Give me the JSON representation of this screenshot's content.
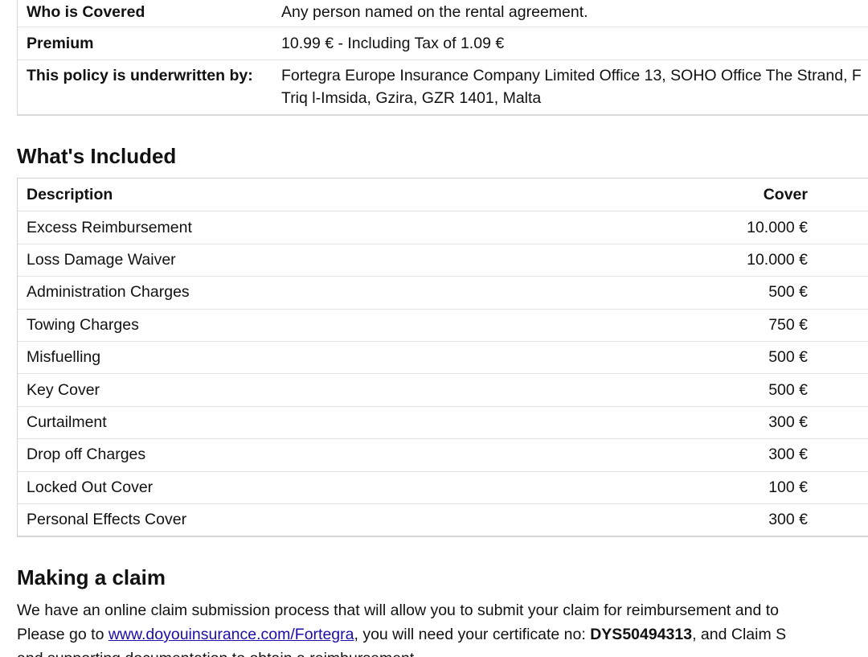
{
  "policy": {
    "rows": [
      {
        "label": "Who is Covered",
        "value": "Any person named on the rental agreement."
      },
      {
        "label": "Premium",
        "value": "10.99 € - Including Tax of 1.09 €"
      },
      {
        "label": "This policy is underwritten by:",
        "value_line1": "Fortegra Europe Insurance Company Limited Office 13, SOHO Office The Strand, F",
        "value_line2": "Triq l-Imsida, Gzira, GZR 1401, Malta"
      }
    ]
  },
  "included": {
    "title": "What's Included",
    "headers": {
      "description": "Description",
      "cover": "Cover"
    },
    "rows": [
      {
        "description": "Excess Reimbursement",
        "cover": "10.000 €"
      },
      {
        "description": "Loss Damage Waiver",
        "cover": "10.000 €"
      },
      {
        "description": "Administration Charges",
        "cover": "500 €"
      },
      {
        "description": "Towing Charges",
        "cover": "750 €"
      },
      {
        "description": "Misfuelling",
        "cover": "500 €"
      },
      {
        "description": "Key Cover",
        "cover": "500 €"
      },
      {
        "description": "Curtailment",
        "cover": "300 €"
      },
      {
        "description": "Drop off Charges",
        "cover": "300 €"
      },
      {
        "description": "Locked Out Cover",
        "cover": "100 €"
      },
      {
        "description": "Personal Effects Cover",
        "cover": "300 €"
      }
    ]
  },
  "claim": {
    "title": "Making a claim",
    "line1": "We have an online claim submission process that will allow you to submit your claim for reimbursement and to",
    "line2_before": "Please go to ",
    "link_text": "www.doyouinsurance.com/Fortegra",
    "line2_middle": ", you will need your certificate no: ",
    "certificate_no": "DYS50494313",
    "line2_after": ", and Claim S",
    "line3": "and supporting documentation to obtain a reimbursement."
  }
}
